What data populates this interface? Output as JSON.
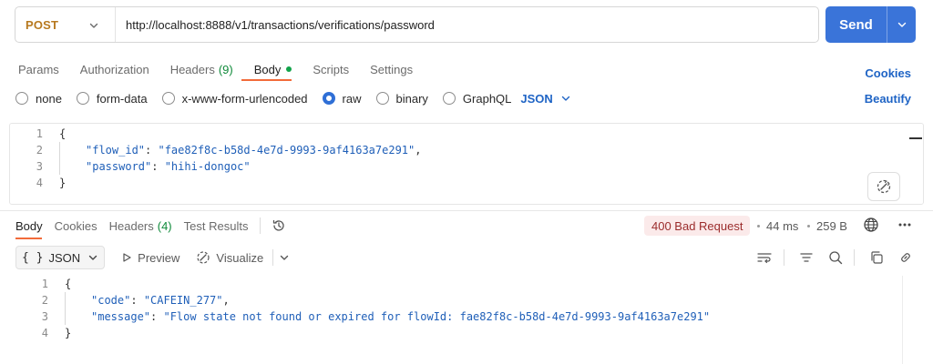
{
  "request": {
    "method": "POST",
    "url": "http://localhost:8888/v1/transactions/verifications/password",
    "send_label": "Send"
  },
  "request_tabs": [
    {
      "label": "Params"
    },
    {
      "label": "Authorization"
    },
    {
      "label": "Headers",
      "count": "(9)"
    },
    {
      "label": "Body",
      "active": true,
      "has_dot": true
    },
    {
      "label": "Scripts"
    },
    {
      "label": "Settings"
    }
  ],
  "links": {
    "cookies": "Cookies",
    "beautify": "Beautify"
  },
  "body_types": [
    {
      "label": "none"
    },
    {
      "label": "form-data"
    },
    {
      "label": "x-www-form-urlencoded"
    },
    {
      "label": "raw",
      "checked": true
    },
    {
      "label": "binary"
    },
    {
      "label": "GraphQL"
    }
  ],
  "body_format": "JSON",
  "request_body": {
    "line_numbers": [
      "1",
      "2",
      "3",
      "4"
    ],
    "open_brace": "{",
    "close_brace": "}",
    "fields": [
      {
        "key": "\"flow_id\"",
        "value": "\"fae82f8c-b58d-4e7d-9993-9af4163a7e291\"",
        "trail": ","
      },
      {
        "key": "\"password\"",
        "value": "\"hihi-dongoc\"",
        "trail": ""
      }
    ]
  },
  "response_tabs": [
    {
      "label": "Body",
      "active": true
    },
    {
      "label": "Cookies"
    },
    {
      "label": "Headers",
      "count": "(4)"
    },
    {
      "label": "Test Results"
    }
  ],
  "response_status": {
    "badge": "400 Bad Request",
    "time": "44 ms",
    "size": "259 B"
  },
  "response_toolbar": {
    "format": "JSON",
    "preview": "Preview",
    "visualize": "Visualize"
  },
  "response_body": {
    "line_numbers": [
      "1",
      "2",
      "3",
      "4"
    ],
    "open_brace": "{",
    "close_brace": "}",
    "fields": [
      {
        "key": "\"code\"",
        "value": "\"CAFEIN_277\"",
        "trail": ","
      },
      {
        "key": "\"message\"",
        "value": "\"Flow state not found or expired for flowId: fae82f8c-b58d-4e7d-9993-9af4163a7e291\"",
        "trail": ""
      }
    ]
  },
  "colors": {
    "accent": "#3a74d9",
    "method": "#b7791f",
    "tab_active_underline": "#f26b3a",
    "error_badge_bg": "#fbeaea",
    "error_badge_text": "#9b2c2c",
    "json_key": "#1f5fb8",
    "body_dot": "#11a34a"
  },
  "icons": {
    "method_chevron": "chevron-down-icon",
    "send_chevron": "chevron-down-icon",
    "beautify": "magic-wand-icon",
    "history": "history-icon",
    "globe": "globe-icon",
    "more": "more-horizontal-icon",
    "preview": "play-icon",
    "visualize": "visualize-icon",
    "wrap": "wrap-lines-icon",
    "filter": "filter-icon",
    "search": "search-icon",
    "copy": "copy-icon",
    "link": "link-icon"
  }
}
